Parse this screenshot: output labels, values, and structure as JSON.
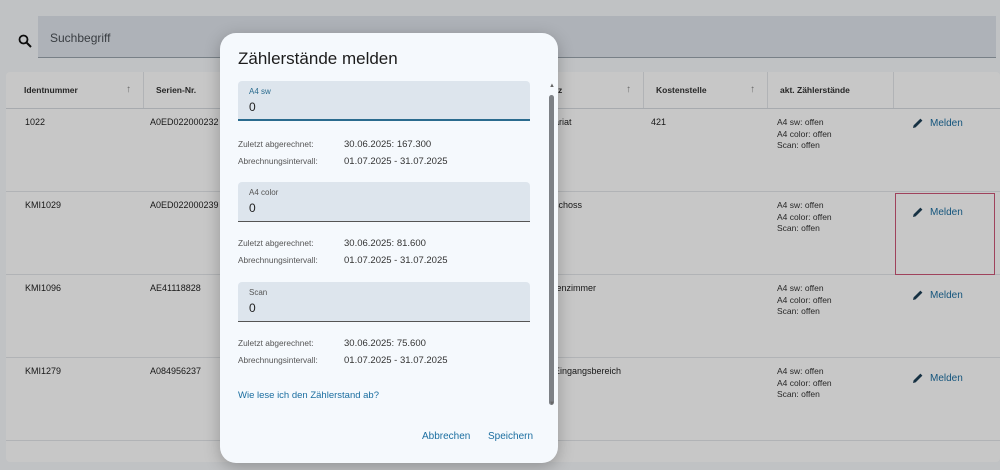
{
  "search": {
    "placeholder": "Suchbegriff"
  },
  "table": {
    "headers": [
      "Identnummer",
      "Serien-Nr.",
      "z",
      "Kostenstelle",
      "akt. Zählerstände"
    ],
    "rows": [
      {
        "id": "1022",
        "serial": "A0ED022000232",
        "location": "ariat",
        "cost_center": "421",
        "status": [
          "A4 sw: offen",
          "A4 color: offen",
          "Scan: offen"
        ],
        "action": "Melden"
      },
      {
        "id": "KMI1029",
        "serial": "A0ED022000239",
        "location": "schoss",
        "cost_center": "",
        "status": [
          "A4 sw: offen",
          "A4 color: offen",
          "Scan: offen"
        ],
        "action": "Melden"
      },
      {
        "id": "KMI1096",
        "serial": "AE41118828",
        "location": "tenzimmer",
        "cost_center": "",
        "status": [
          "A4 sw: offen",
          "A4 color: offen",
          "Scan: offen"
        ],
        "action": "Melden"
      },
      {
        "id": "KMI1279",
        "serial": "A084956237",
        "location": "Eingangsbereich",
        "cost_center": "",
        "status": [
          "A4 sw: offen",
          "A4 color: offen",
          "Scan: offen"
        ],
        "action": "Melden"
      }
    ]
  },
  "dialog": {
    "title": "Zählerstände melden",
    "fields": [
      {
        "label": "A4 sw",
        "value": "0",
        "last_label": "Zuletzt abgerechnet:",
        "last_value": "30.06.2025: 167.300",
        "interval_label": "Abrechnungsintervall:",
        "interval_value": "01.07.2025 - 31.07.2025"
      },
      {
        "label": "A4 color",
        "value": "0",
        "last_label": "Zuletzt abgerechnet:",
        "last_value": "30.06.2025: 81.600",
        "interval_label": "Abrechnungsintervall:",
        "interval_value": "01.07.2025 - 31.07.2025"
      },
      {
        "label": "Scan",
        "value": "0",
        "last_label": "Zuletzt abgerechnet:",
        "last_value": "30.06.2025: 75.600",
        "interval_label": "Abrechnungsintervall:",
        "interval_value": "01.07.2025 - 31.07.2025"
      }
    ],
    "help_link": "Wie lese ich den Zählerstand ab?",
    "cancel": "Abbrechen",
    "save": "Speichern"
  },
  "colors": {
    "accent": "#1b6ea0",
    "field_bg": "#dde5ed",
    "dialog_bg": "#f5f9fd"
  },
  "icons": {
    "search": "search-icon",
    "edit": "pencil-icon"
  }
}
